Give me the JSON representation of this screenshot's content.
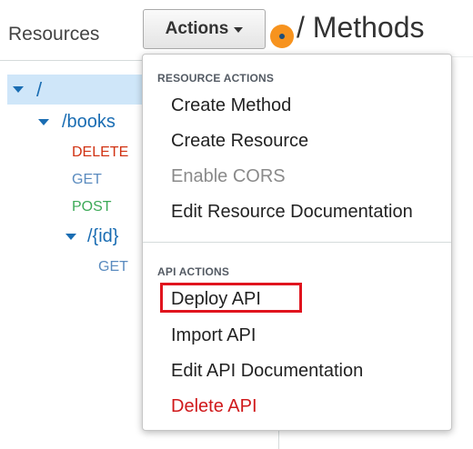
{
  "left_pane": {
    "title": "Resources",
    "tree": {
      "root": {
        "path": "/"
      },
      "books": {
        "path": "/books"
      },
      "books_methods": [
        "DELETE",
        "GET",
        "POST"
      ],
      "id": {
        "path": "/{id}"
      },
      "id_methods": [
        "GET"
      ]
    }
  },
  "toolbar": {
    "actions_label": "Actions"
  },
  "header": {
    "title": "/ Methods"
  },
  "actions_menu": {
    "resource_section_label": "RESOURCE ACTIONS",
    "resource_items": [
      {
        "label": "Create Method",
        "state": "enabled"
      },
      {
        "label": "Create Resource",
        "state": "enabled"
      },
      {
        "label": "Enable CORS",
        "state": "disabled"
      },
      {
        "label": "Edit Resource Documentation",
        "state": "enabled"
      }
    ],
    "api_section_label": "API ACTIONS",
    "api_items": [
      {
        "label": "Deploy API",
        "state": "highlighted"
      },
      {
        "label": "Import API",
        "state": "enabled"
      },
      {
        "label": "Edit API Documentation",
        "state": "enabled"
      },
      {
        "label": "Delete API",
        "state": "danger"
      }
    ]
  },
  "colors": {
    "link_blue": "#1a6db3",
    "method_delete": "#d13212",
    "method_get": "#5a8bbf",
    "method_post": "#3daa58",
    "selected_row_bg": "#cfe6f9",
    "hint_orange": "#f7931e",
    "highlight_red": "#e0141e",
    "danger_red": "#d0191b"
  }
}
